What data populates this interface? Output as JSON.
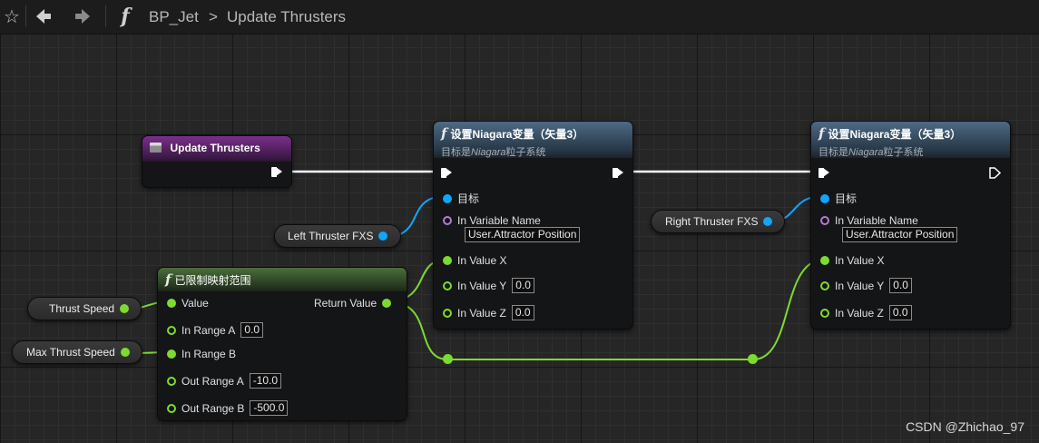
{
  "toolbar": {
    "star_icon": "star-outline-icon",
    "back_icon": "arrow-left-icon",
    "forward_icon": "arrow-right-icon",
    "function_glyph": "f",
    "breadcrumb_root": "BP_Jet",
    "breadcrumb_sep": ">",
    "breadcrumb_current": "Update Thrusters"
  },
  "colors": {
    "float_pin": "#7cdb2f",
    "object_pin": "#0ea6ff",
    "name_pin": "#b57ad6",
    "exec_wire": "#ffffff"
  },
  "event_node": {
    "title": "Update Thrusters"
  },
  "set_node_left": {
    "glyph": "f",
    "title": "设置Niagara变量（矢量3）",
    "subtitle_prefix": "目标是",
    "subtitle_italic": "Niagara",
    "subtitle_suffix": "粒子系统",
    "target_label": "目标",
    "var_name_label": "In Variable Name",
    "var_name_value": "User.Attractor Position",
    "x_label": "In Value X",
    "y_label": "In Value Y",
    "y_value": "0.0",
    "z_label": "In Value Z",
    "z_value": "0.0"
  },
  "set_node_right": {
    "glyph": "f",
    "title": "设置Niagara变量（矢量3）",
    "subtitle_prefix": "目标是",
    "subtitle_italic": "Niagara",
    "subtitle_suffix": "粒子系统",
    "target_label": "目标",
    "var_name_label": "In Variable Name",
    "var_name_value": "User.Attractor Position",
    "x_label": "In Value X",
    "y_label": "In Value Y",
    "y_value": "0.0",
    "z_label": "In Value Z",
    "z_value": "0.0"
  },
  "range_node": {
    "glyph": "f",
    "title": "已限制映射范围",
    "value_label": "Value",
    "return_label": "Return Value",
    "in_a_label": "In Range A",
    "in_a_value": "0.0",
    "in_b_label": "In Range B",
    "out_a_label": "Out Range A",
    "out_a_value": "-10.0",
    "out_b_label": "Out Range B",
    "out_b_value": "-500.0"
  },
  "variables": {
    "left_fxs": "Left Thruster FXS",
    "right_fxs": "Right Thruster FXS",
    "thrust_speed": "Thrust Speed",
    "max_thrust_speed": "Max Thrust Speed"
  },
  "watermark": "CSDN @Zhichao_97"
}
